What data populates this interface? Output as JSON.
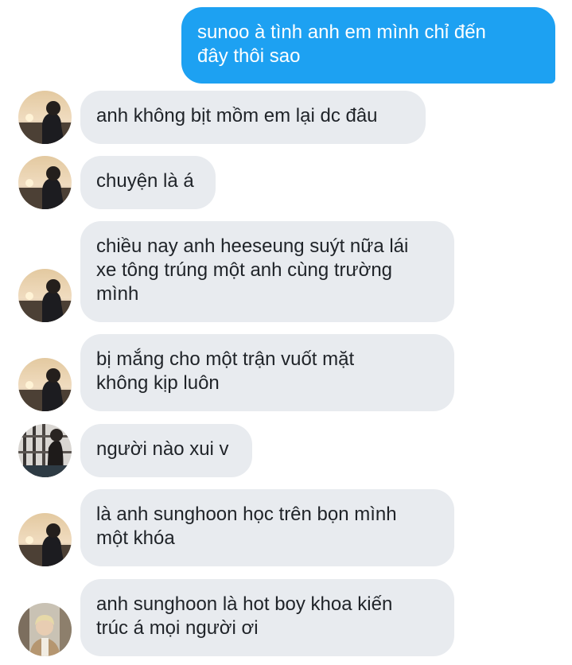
{
  "conversation": {
    "messages": [
      {
        "side": "out",
        "text": "sunoo à tình anh em mình chỉ đến\nđây thôi sao"
      },
      {
        "side": "in",
        "avatar": "sunset-avatar-icon",
        "text": "anh không bịt mồm em lại dc đâu"
      },
      {
        "side": "in",
        "avatar": "sunset-avatar-icon",
        "text": "chuyện là á"
      },
      {
        "side": "in",
        "avatar": "sunset-avatar-icon",
        "text": "chiều nay anh heeseung suýt nữa lái\nxe tông trúng một anh cùng trường\nmình"
      },
      {
        "side": "in",
        "avatar": "sunset-avatar-icon",
        "text": "bị mắng cho một trận vuốt mặt\nkhông kịp luôn"
      },
      {
        "side": "in",
        "avatar": "window-avatar-icon",
        "text": "người nào xui v"
      },
      {
        "side": "in",
        "avatar": "sunset-avatar-icon",
        "text": "là anh sunghoon học trên bọn mình\nmột khóa"
      },
      {
        "side": "in",
        "avatar": "blonde-avatar-icon",
        "text": "anh sunghoon là hot boy khoa kiến\ntrúc á mọi người ơi"
      }
    ]
  },
  "colors": {
    "outgoing_bubble": "#1da1f2",
    "incoming_bubble": "#e8ebef",
    "incoming_text": "#1f2328"
  }
}
